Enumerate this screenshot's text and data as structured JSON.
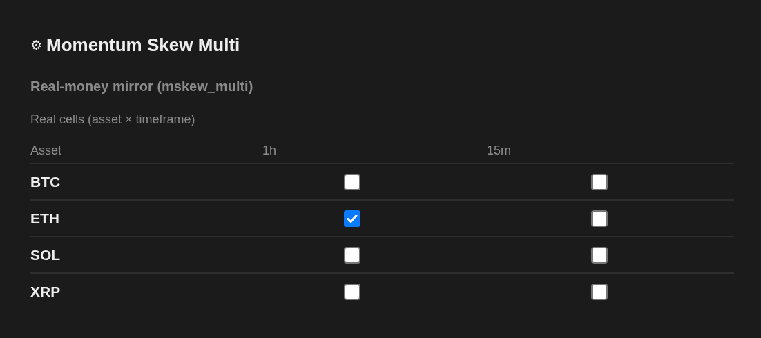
{
  "panel": {
    "icon": "⚙",
    "title": "Momentum Skew Multi",
    "subtitle": "Real-money mirror (mskew_multi)",
    "caption": "Real cells (asset × timeframe)"
  },
  "table": {
    "columns": [
      "Asset",
      "1h",
      "15m"
    ],
    "rows": [
      {
        "asset": "BTC",
        "cells": [
          {
            "checked": false
          },
          {
            "checked": false
          }
        ]
      },
      {
        "asset": "ETH",
        "cells": [
          {
            "checked": true
          },
          {
            "checked": false
          }
        ]
      },
      {
        "asset": "SOL",
        "cells": [
          {
            "checked": false
          },
          {
            "checked": false
          }
        ]
      },
      {
        "asset": "XRP",
        "cells": [
          {
            "checked": false
          },
          {
            "checked": false
          }
        ]
      }
    ]
  }
}
